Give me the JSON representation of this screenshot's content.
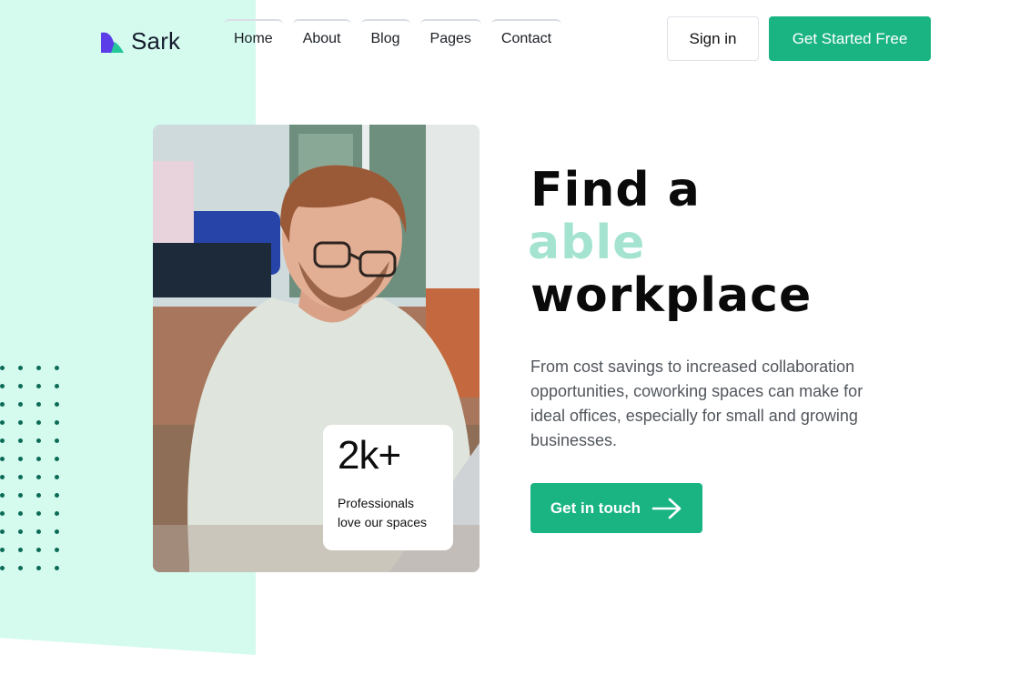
{
  "brand": {
    "name": "Sark",
    "logo_icon": "sark-logo-icon",
    "accent_color": "#1ab483",
    "mint_color": "#d5fbef"
  },
  "nav": {
    "items": [
      {
        "label": "Home"
      },
      {
        "label": "About"
      },
      {
        "label": "Blog"
      },
      {
        "label": "Pages"
      },
      {
        "label": "Contact"
      }
    ]
  },
  "header": {
    "signin_label": "Sign in",
    "cta_label": "Get Started Free"
  },
  "hero": {
    "headline_line1": "Find a",
    "headline_accent": "able",
    "headline_line3": "workplace",
    "subtitle": "From cost savings to increased collaboration opportunities, coworking spaces can make for ideal offices, especially for small and growing businesses.",
    "cta_label": "Get in touch",
    "cta_icon": "arrow-right-icon",
    "image_alt": "man-working-on-laptop-photo"
  },
  "stat": {
    "value": "2k+",
    "label_line1": "Professionals",
    "label_line2": "love our spaces"
  }
}
